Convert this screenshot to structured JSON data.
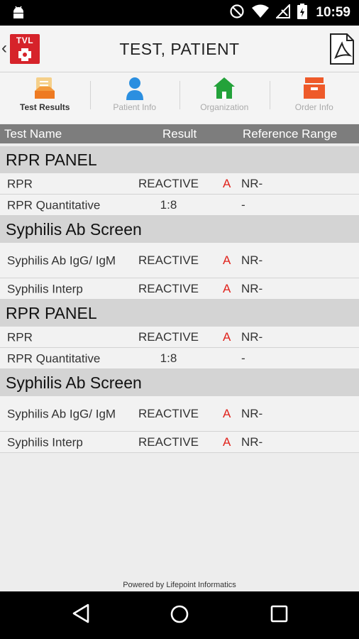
{
  "status_bar": {
    "time": "10:59"
  },
  "header": {
    "title": "TEST, PATIENT",
    "logo_text": "TVL"
  },
  "tabs": [
    {
      "label": "Test Results",
      "icon": "test-results-icon",
      "active": true
    },
    {
      "label": "Patient Info",
      "icon": "person-icon",
      "active": false
    },
    {
      "label": "Organization",
      "icon": "house-icon",
      "active": false
    },
    {
      "label": "Order Info",
      "icon": "order-box-icon",
      "active": false
    }
  ],
  "table_header": {
    "name": "Test Name",
    "result": "Result",
    "range": "Reference Range"
  },
  "groups": [
    {
      "title": "RPR PANEL",
      "rows": [
        {
          "name": "RPR",
          "result": "REACTIVE",
          "flag": "A",
          "range": "NR-"
        },
        {
          "name": "RPR Quantitative",
          "result": "1:8",
          "flag": "",
          "range": "-"
        }
      ]
    },
    {
      "title": "Syphilis Ab Screen",
      "rows": [
        {
          "name": "Syphilis Ab IgG/ IgM",
          "result": "REACTIVE",
          "flag": "A",
          "range": "NR-"
        },
        {
          "name": "Syphilis Interp",
          "result": "REACTIVE",
          "flag": "A",
          "range": "NR-"
        }
      ]
    },
    {
      "title": "RPR PANEL",
      "rows": [
        {
          "name": "RPR",
          "result": "REACTIVE",
          "flag": "A",
          "range": "NR-"
        },
        {
          "name": "RPR Quantitative",
          "result": "1:8",
          "flag": "",
          "range": "-"
        }
      ]
    },
    {
      "title": "Syphilis Ab Screen",
      "rows": [
        {
          "name": "Syphilis Ab IgG/ IgM",
          "result": "REACTIVE",
          "flag": "A",
          "range": "NR-"
        },
        {
          "name": "Syphilis Interp",
          "result": "REACTIVE",
          "flag": "A",
          "range": "NR-"
        }
      ]
    }
  ],
  "footer": {
    "text": "Powered by Lifepoint Informatics"
  },
  "colors": {
    "flag": "#e0231c",
    "logo": "#d6232a",
    "header_bar": "#7d7d7d",
    "section_bg": "#d4d4d4"
  }
}
